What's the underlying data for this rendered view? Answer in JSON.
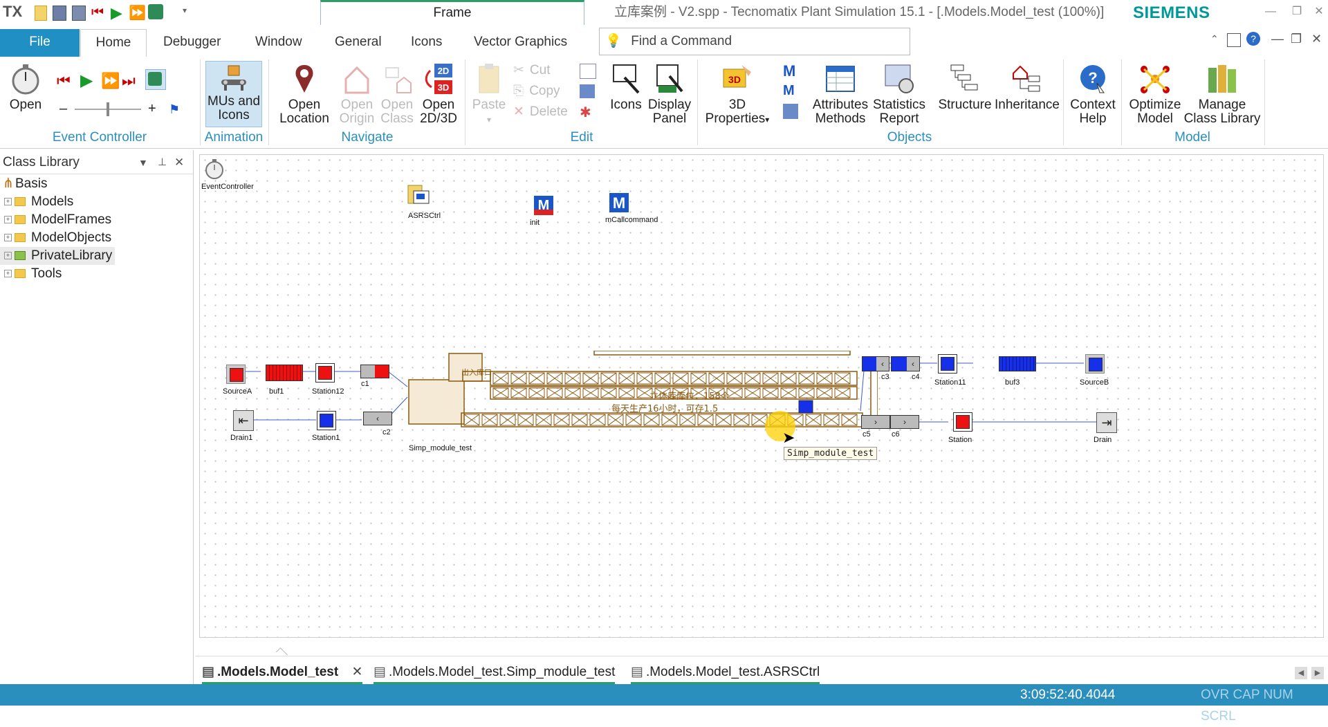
{
  "titlebar": {
    "app_abbrev": "TX",
    "frame_tab": "Frame",
    "window_title": "立库案例 - V2.spp - Tecnomatix Plant Simulation 15.1 - [.Models.Model_test  (100%)]",
    "brand": "SIEMENS"
  },
  "tabs": [
    "File",
    "Home",
    "Debugger",
    "Window",
    "General",
    "Icons",
    "Vector Graphics"
  ],
  "command_search": {
    "placeholder": "Find a Command"
  },
  "ribbon": {
    "event_controller": {
      "open": "Open",
      "minus": "–",
      "plus": "+",
      "group": "Event Controller"
    },
    "animation": {
      "mus_icons_1": "MUs and",
      "mus_icons_2": "Icons",
      "group": "Animation"
    },
    "navigate": {
      "open_location_1": "Open",
      "open_location_2": "Location",
      "open_origin_1": "Open",
      "open_origin_2": "Origin",
      "open_class_1": "Open",
      "open_class_2": "Class",
      "open_2d3d_1": "Open",
      "open_2d3d_2": "2D/3D",
      "group": "Navigate"
    },
    "edit": {
      "paste": "Paste",
      "cut": "Cut",
      "copy": "Copy",
      "delete": "Delete",
      "icons": "Icons",
      "display_1": "Display",
      "display_2": "Panel",
      "group": "Edit"
    },
    "objects": {
      "props_1": "3D",
      "props_2": "Properties",
      "attr_1": "Attributes",
      "attr_2": "Methods",
      "stats_1": "Statistics",
      "stats_2": "Report",
      "structure": "Structure",
      "inheritance": "Inheritance",
      "group": "Objects"
    },
    "help": {
      "ctx_1": "Context",
      "ctx_2": "Help"
    },
    "model": {
      "opt_1": "Optimize",
      "opt_2": "Model",
      "lib_1": "Manage",
      "lib_2": "Class Library",
      "group": "Model"
    }
  },
  "class_library": {
    "title": "Class Library",
    "root": "Basis",
    "items": [
      "Models",
      "ModelFrames",
      "ModelObjects",
      "PrivateLibrary",
      "Tools"
    ]
  },
  "canvas": {
    "event_controller": "EventController",
    "asrs": "ASRSCtrl",
    "init": "init",
    "mcall": "mCallcommand",
    "sourceA": "SourceA",
    "buf1": "buf1",
    "station12": "Station12",
    "c1": "c1",
    "drain1": "Drain1",
    "station1": "Station1",
    "c2": "c2",
    "module": "Simp_module_test",
    "c3": "c3",
    "c4": "c4",
    "station11": "Station11",
    "buf3": "buf3",
    "sourceB": "SourceB",
    "c5": "c5",
    "c6": "c6",
    "station": "Station",
    "drain": "Drain",
    "cn_text1": "每天生产16小时，可存1.5",
    "cn_text2": "立体库库位：158个",
    "cn_text3": "出入库口",
    "tooltip": "Simp_module_test"
  },
  "doc_tabs": [
    ".Models.Model_test",
    ".Models.Model_test.Simp_module_test",
    ".Models.Model_test.ASRSCtrl"
  ],
  "status": {
    "time": "3:09:52:40.4044",
    "flags": "OVR CAP NUM SCRL"
  }
}
